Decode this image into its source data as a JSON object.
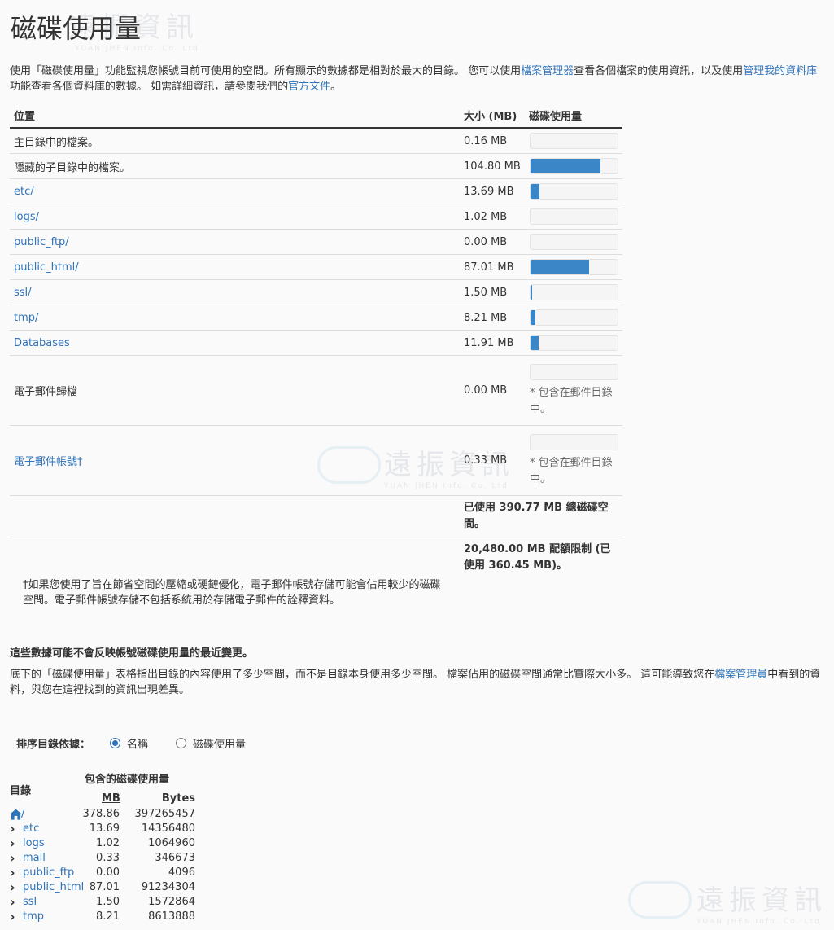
{
  "page": {
    "title": "磁碟使用量",
    "intro_part1": "使用「磁碟使用量」功能監視您帳號目前可使用的空間。所有顯示的數據都是相對於最大的目錄。 您可以使用",
    "intro_link1": "檔案管理器",
    "intro_part2": "查看各個檔案的使用資訊，以及使用",
    "intro_link2": "管理我的資料庫",
    "intro_part3": "功能查看各個資料庫的數據。 如需詳細資訊，請參閱我們的",
    "intro_link3": "官方文件",
    "intro_part4": "。"
  },
  "watermark": {
    "brand": "遠振資訊",
    "sub": "YUAN JHEN Info. Co. Ltd"
  },
  "disk_table": {
    "headers": {
      "location": "位置",
      "size": "大小 (MB)",
      "usage": "磁碟使用量"
    },
    "rows": [
      {
        "label": "主目錄中的檔案。",
        "link": false,
        "size": "0.16 MB",
        "fill": 0.0
      },
      {
        "label": "隱藏的子目錄中的檔案。",
        "link": false,
        "size": "104.80 MB",
        "fill": 0.8
      },
      {
        "label": "etc/",
        "link": true,
        "size": "13.69 MB",
        "fill": 0.1
      },
      {
        "label": "logs/",
        "link": true,
        "size": "1.02 MB",
        "fill": 0.0
      },
      {
        "label": "public_ftp/",
        "link": true,
        "size": "0.00 MB",
        "fill": 0.0
      },
      {
        "label": "public_html/",
        "link": true,
        "size": "87.01 MB",
        "fill": 0.67
      },
      {
        "label": "ssl/",
        "link": true,
        "size": "1.50 MB",
        "fill": 0.02
      },
      {
        "label": "tmp/",
        "link": true,
        "size": "8.21 MB",
        "fill": 0.06
      },
      {
        "label": "Databases",
        "link": true,
        "size": "11.91 MB",
        "fill": 0.09
      }
    ],
    "email_archive": {
      "label": "電子郵件歸檔",
      "size": "0.00 MB",
      "note": "* 包含在郵件目錄中。"
    },
    "email_accounts": {
      "label": "電子郵件帳號†",
      "size": "0.33 MB",
      "note": "* 包含在郵件目錄中。"
    },
    "total_used": "已使用 390.77 MB 總磁碟空間。",
    "quota": "20,480.00 MB 配額限制 (已使用 360.45 MB)。"
  },
  "footnote": "†如果您使用了旨在節省空間的壓縮或硬鏈優化，電子郵件帳號存儲可能會佔用較少的磁碟空間。電子郵件帳號存儲不包括系統用於存儲電子郵件的詮釋資料。",
  "warning": "這些數據可能不會反映帳號磁碟使用量的最近變更。",
  "para2_part1": "底下的「磁碟使用量」表格指出目錄的內容使用了多少空間，而不是目錄本身使用多少空間。 檔案佔用的磁碟空間通常比實際大小多。 這可能導致您在",
  "para2_link": "檔案管理員",
  "para2_part2": "中看到的資料，與您在這裡找到的資訊出現差異。",
  "sort": {
    "label": "排序目錄依據：",
    "option_name": "名稱",
    "option_usage": "磁碟使用量",
    "selected": "name"
  },
  "dir_table": {
    "header_dir": "目錄",
    "header_group": "包含的磁碟使用量",
    "header_mb": "MB",
    "header_bytes": "Bytes",
    "root": {
      "name": "/",
      "mb": "378.86",
      "bytes": "397265457"
    },
    "rows": [
      {
        "name": "etc",
        "mb": "13.69",
        "bytes": "14356480"
      },
      {
        "name": "logs",
        "mb": "1.02",
        "bytes": "1064960"
      },
      {
        "name": "mail",
        "mb": "0.33",
        "bytes": "346673"
      },
      {
        "name": "public_ftp",
        "mb": "0.00",
        "bytes": "4096"
      },
      {
        "name": "public_html",
        "mb": "87.01",
        "bytes": "91234304"
      },
      {
        "name": "ssl",
        "mb": "1.50",
        "bytes": "1572864"
      },
      {
        "name": "tmp",
        "mb": "8.21",
        "bytes": "8613888"
      }
    ]
  }
}
